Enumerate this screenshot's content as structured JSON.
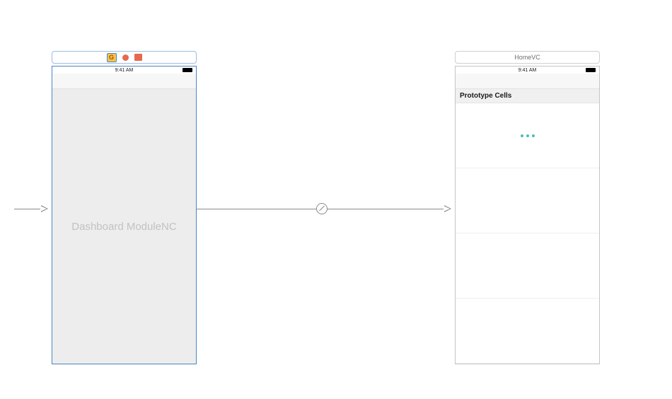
{
  "scenes": {
    "dashboard": {
      "status_time": "9:41 AM",
      "placeholder": "Dashboard ModuleNC"
    },
    "home": {
      "header_title": "HomeVC",
      "status_time": "9:41 AM",
      "section_header": "Prototype Cells"
    }
  }
}
